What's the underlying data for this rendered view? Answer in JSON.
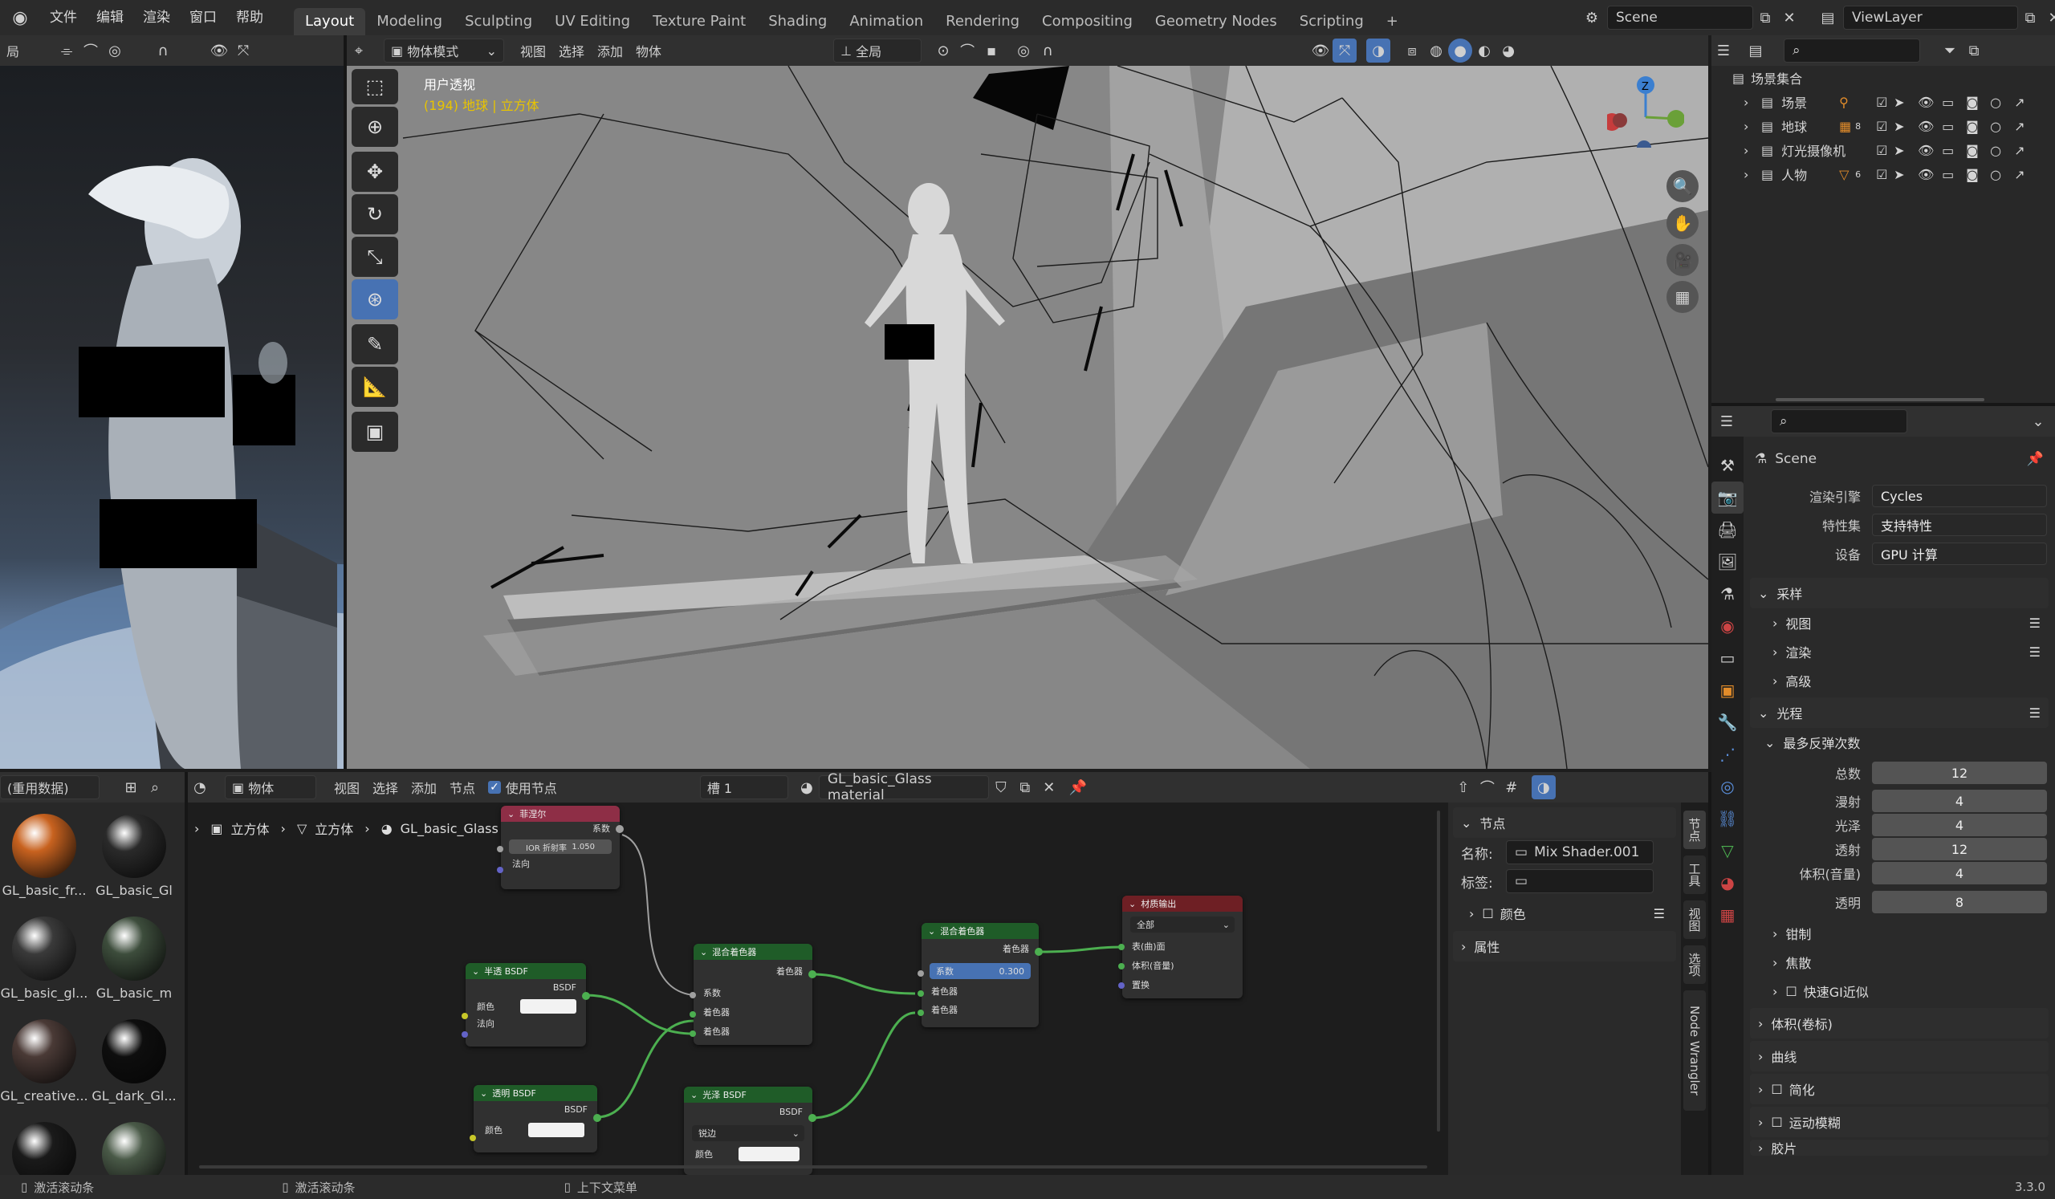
{
  "topbar": {
    "menus": [
      "文件",
      "编辑",
      "渲染",
      "窗口",
      "帮助"
    ],
    "workspaces": [
      "Layout",
      "Modeling",
      "Sculpting",
      "UV Editing",
      "Texture Paint",
      "Shading",
      "Animation",
      "Rendering",
      "Compositing",
      "Geometry Nodes",
      "Scripting"
    ],
    "scene": "Scene",
    "viewlayer": "ViewLayer",
    "add_tab": "+"
  },
  "left_header": {
    "mode": "局"
  },
  "viewport": {
    "mode": "物体模式",
    "menus": [
      "视图",
      "选择",
      "添加",
      "物体"
    ],
    "orientation": "全局",
    "overlay_title": "用户透视",
    "overlay_sub": "(194) 地球 | 立方体",
    "gizmo_z": "Z"
  },
  "outliner": {
    "root": "场景集合",
    "items": [
      {
        "label": "场景",
        "badge": ""
      },
      {
        "label": "地球",
        "badge": "8"
      },
      {
        "label": "灯光摄像机",
        "badge": ""
      },
      {
        "label": "人物",
        "badge": "6"
      }
    ]
  },
  "properties": {
    "scene": "Scene",
    "rows": [
      {
        "label": "渲染引擎",
        "value": "Cycles"
      },
      {
        "label": "特性集",
        "value": "支持特性"
      },
      {
        "label": "设备",
        "value": "GPU 计算"
      }
    ],
    "sampling": "采样",
    "sampling_sub": [
      "视图",
      "渲染",
      "高级"
    ],
    "light_paths": "光程",
    "max_bounces": "最多反弹次数",
    "bounces": [
      {
        "label": "总数",
        "value": "12"
      },
      {
        "label": "漫射",
        "value": "4"
      },
      {
        "label": "光泽",
        "value": "4"
      },
      {
        "label": "透射",
        "value": "12"
      },
      {
        "label": "体积(音量)",
        "value": "4"
      },
      {
        "label": "透明",
        "value": "8"
      }
    ],
    "lp_sub": [
      "钳制",
      "焦散",
      "快速GI近似"
    ],
    "sections": [
      "体积(卷标)",
      "曲线",
      "简化",
      "运动模糊",
      "胶片"
    ]
  },
  "asset_panel": {
    "header": "(重用数据)",
    "materials": [
      {
        "name": "GL_basic_fr...",
        "color": "#c8621f"
      },
      {
        "name": "GL_basic_Gl",
        "color": "#2a2a2a"
      },
      {
        "name": "GL_basic_gl...",
        "color": "#3a3a3a"
      },
      {
        "name": "GL_basic_m",
        "color": "#3d4d3c"
      },
      {
        "name": "GL_creative...",
        "color": "#4a3a36"
      },
      {
        "name": "GL_dark_Gl...",
        "color": "#0e0e0e"
      },
      {
        "name": "",
        "color": "#1a1a1a"
      },
      {
        "name": "",
        "color": "#4a5a48"
      }
    ]
  },
  "node_editor": {
    "mode": "物体",
    "menus": [
      "视图",
      "选择",
      "添加",
      "节点"
    ],
    "use_nodes": "使用节点",
    "slot": "槽 1",
    "material": "GL_basic_Glass material",
    "breadcrumb": [
      "立方体",
      "立方体",
      "GL_basic_Glass material"
    ]
  },
  "nodes": {
    "fresnel": {
      "title": "菲涅尔",
      "out": "系数",
      "ior": "IOR 折射率",
      "ior_val": "1.050",
      "normal": "法向"
    },
    "translucent": {
      "title": "半透 BSDF",
      "out": "BSDF",
      "color": "颜色",
      "normal": "法向"
    },
    "mix1": {
      "title": "混合着色器",
      "out": "着色器",
      "fac": "系数",
      "s1": "着色器",
      "s2": "着色器"
    },
    "mix2": {
      "title": "混合着色器",
      "out": "着色器",
      "fac": "系数",
      "fac_val": "0.300",
      "s1": "着色器",
      "s2": "着色器"
    },
    "transparent": {
      "title": "透明 BSDF",
      "out": "BSDF",
      "color": "颜色"
    },
    "glossy": {
      "title": "光泽 BSDF",
      "out": "BSDF",
      "dist": "锐边",
      "color": "颜色"
    },
    "output": {
      "title": "材质输出",
      "target": "全部",
      "surface": "表(曲)面",
      "volume": "体积(音量)",
      "disp": "置换"
    }
  },
  "node_side": {
    "node_panel": "节点",
    "name_label": "名称:",
    "name_val": "Mix Shader.001",
    "label_label": "标签:",
    "color": "颜色",
    "props": "属性",
    "tabs": [
      "节点",
      "工具",
      "视图",
      "选项",
      "Node Wrangler"
    ]
  },
  "statusbar": {
    "left": "激活滚动条",
    "mid": "激活滚动条",
    "ctx": "上下文菜单",
    "version": "3.3.0"
  }
}
